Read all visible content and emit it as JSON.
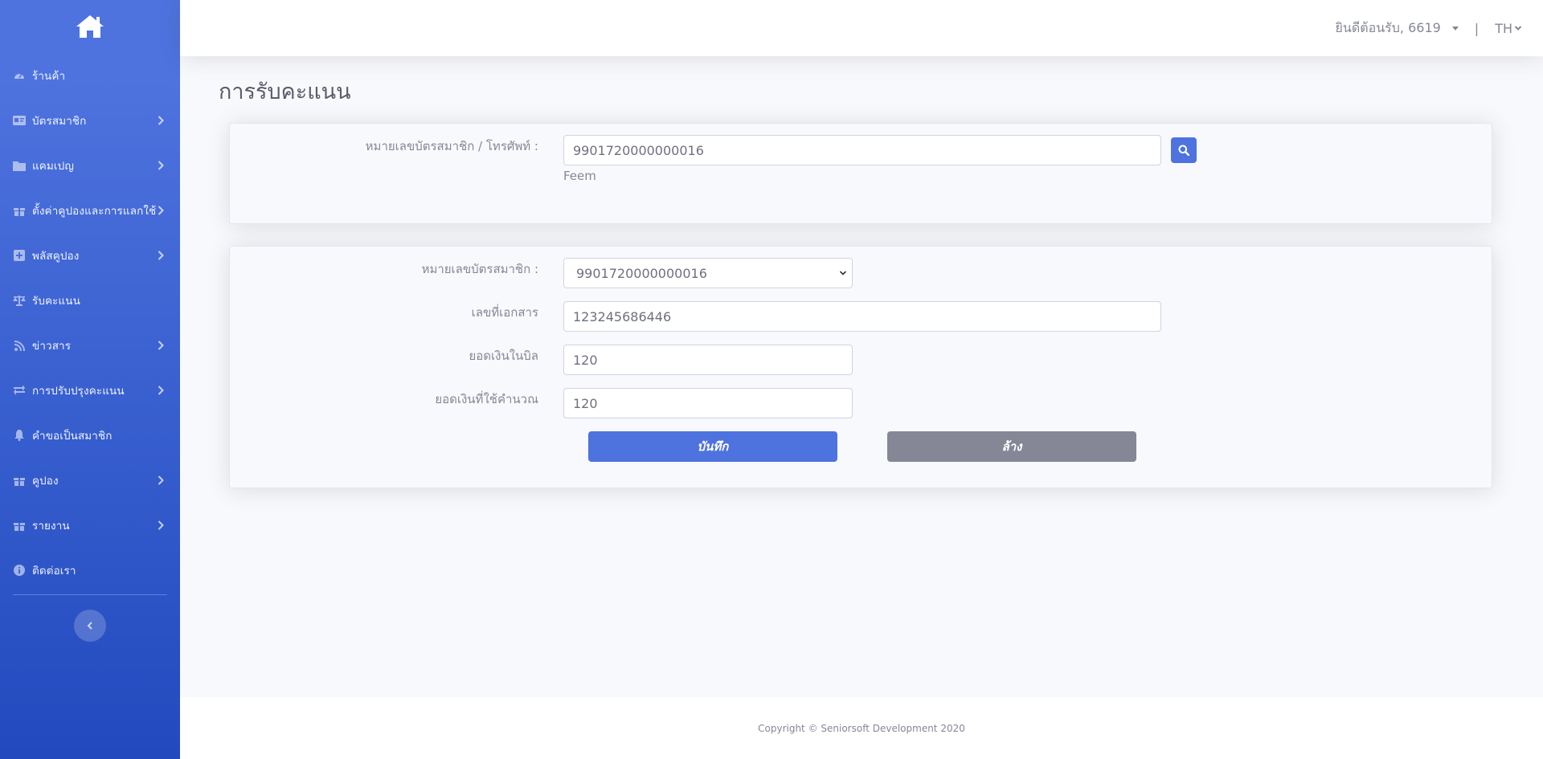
{
  "sidebar": {
    "brand_icon": "home-icon",
    "items": [
      {
        "label": "ร้านค้า",
        "icon": "tachometer-icon",
        "has_arrow": false
      },
      {
        "label": "บัตรสมาชิก",
        "icon": "id-card-icon",
        "has_arrow": true
      },
      {
        "label": "แคมเปญ",
        "icon": "folder-icon",
        "has_arrow": true
      },
      {
        "label": "ตั้งค่าคูปองและการแลกใช้",
        "icon": "gift-icon",
        "has_arrow": true
      },
      {
        "label": "พลัสคูปอง",
        "icon": "plus-square-icon",
        "has_arrow": true
      },
      {
        "label": "รับคะแนน",
        "icon": "balance-scale-icon",
        "has_arrow": false
      },
      {
        "label": "ข่าวสาร",
        "icon": "rss-icon",
        "has_arrow": true
      },
      {
        "label": "การปรับปรุงคะแนน",
        "icon": "exchange-icon",
        "has_arrow": true
      },
      {
        "label": "คำขอเป็นสมาชิก",
        "icon": "bell-icon",
        "has_arrow": false
      },
      {
        "label": "คูปอง",
        "icon": "gift-icon",
        "has_arrow": true
      },
      {
        "label": "รายงาน",
        "icon": "gift-icon",
        "has_arrow": true
      },
      {
        "label": "ติดต่อเรา",
        "icon": "info-circle-icon",
        "has_arrow": false
      }
    ]
  },
  "topbar": {
    "welcome": "ยินดีต้อนรับ, 6619",
    "separator": "|",
    "language": "TH"
  },
  "page": {
    "title": "การรับคะแนน"
  },
  "search_card": {
    "label": "หมายเลขบัตรสมาชิก / โทรศัพท์ :",
    "value": "9901720000000016",
    "member_name": "Feem"
  },
  "form": {
    "card_label": "หมายเลขบัตรสมาชิก :",
    "card_selected": "9901720000000016",
    "doc_label": "เลขที่เอกสาร",
    "doc_value": "123245686446",
    "bill_label": "ยอดเงินในบิล",
    "bill_value": "120",
    "calc_label": "ยอดเงินที่ใช้คำนวณ",
    "calc_value": "120",
    "save_label": "บันทึก",
    "clear_label": "ล้าง"
  },
  "footer": {
    "copyright": "Copyright © Seniorsoft Development 2020"
  },
  "colors": {
    "primary": "#4e73df",
    "secondary": "#858796",
    "sidebar_gradient_end": "#224abe"
  }
}
